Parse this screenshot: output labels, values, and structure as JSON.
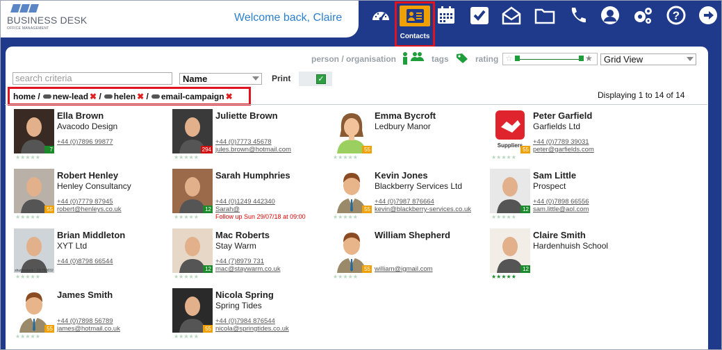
{
  "brand": {
    "name": "BUSINESS DESK",
    "tagline": "OFFICE MANAGEMENT"
  },
  "header": {
    "welcome": "Welcome back, Claire"
  },
  "nav": {
    "icons": [
      "dashboard-icon",
      "contacts-icon",
      "calendar-icon",
      "tasks-icon",
      "mail-icon",
      "folder-icon",
      "phone-icon",
      "user-icon",
      "settings-icon",
      "help-icon",
      "logout-icon"
    ],
    "contacts_label": "Contacts"
  },
  "filters": {
    "person_org": "person / organisation",
    "tags": "tags",
    "rating": "rating",
    "view": "Grid View",
    "search_placeholder": "search criteria",
    "sort": "Name",
    "print": "Print"
  },
  "breadcrumb": {
    "home": "home",
    "items": [
      "new-lead",
      "helen",
      "email-campaign"
    ]
  },
  "display_text": "Displaying 1 to 14 of 14",
  "contacts": [
    {
      "name": "Ella Brown",
      "company": "Avacodo Design",
      "phone": "+44 (0)7896 99877",
      "email": "",
      "badge": "7",
      "badge_color": "#1a8a2a",
      "stars_filled": 0,
      "avatar": "photo-ella"
    },
    {
      "name": "Juliette Brown",
      "company": "",
      "phone": "+44 (0)7773 45678",
      "email": "jules.brown@hotmail.com",
      "badge": "294",
      "badge_color": "#d01010",
      "stars_filled": 0,
      "avatar": "photo-juliette"
    },
    {
      "name": "Emma Bycroft",
      "company": "Ledbury Manor",
      "phone": "",
      "email": "",
      "badge": "55",
      "badge_color": "#f0a000",
      "stars_filled": 0,
      "avatar": "female-avatar"
    },
    {
      "name": "Peter Garfield",
      "company": "Garfields Ltd",
      "phone": "+44 (0)7789 39031",
      "email": "peter@garfields.com",
      "badge": "55",
      "badge_color": "#f0a000",
      "stars_filled": 0,
      "avatar": "suppliers-logo",
      "logo_text": "Suppliers"
    },
    {
      "name": "Robert Henley",
      "company": "Henley Consultancy",
      "phone": "+44 (0)7779 87945",
      "email": "robert@henleys.co.uk",
      "badge": "55",
      "badge_color": "#f0a000",
      "stars_filled": 0,
      "avatar": "photo-robert"
    },
    {
      "name": "Sarah Humphries",
      "company": "",
      "phone": "+44 (0)1249 442340",
      "email": "Sarah@",
      "follow": "Follow up Sun 29/07/18 at 09:00",
      "badge": "12",
      "badge_color": "#1a8a2a",
      "stars_filled": 0,
      "avatar": "photo-sarah"
    },
    {
      "name": "Kevin Jones",
      "company": "Blackberry Services Ltd",
      "phone": "+44 (0)7987 876664",
      "email": "kevin@blackberry-services.co.uk",
      "badge": "55",
      "badge_color": "#f0a000",
      "stars_filled": 0,
      "avatar": "male-avatar"
    },
    {
      "name": "Sam Little",
      "company": "Prospect",
      "phone": "+44 (0)7898 66556",
      "email": "sam.little@aol.com",
      "badge": "12",
      "badge_color": "#1a8a2a",
      "stars_filled": 0,
      "avatar": "photo-sam"
    },
    {
      "name": "Brian Middleton",
      "company": "XYT Ltd",
      "phone": "+44 (0)8798 66544",
      "email": "",
      "badge": "",
      "badge_color": "#1a8a2a",
      "stars_filled": 0,
      "avatar": "photo-brian",
      "logo_text": "shutterstock - 111750032"
    },
    {
      "name": "Mac Roberts",
      "company": "Stay Warm",
      "phone": "+44 (7)8979 731",
      "email": "mac@staywarm.co.uk",
      "badge": "12",
      "badge_color": "#1a8a2a",
      "stars_filled": 0,
      "avatar": "photo-mac"
    },
    {
      "name": "William Shepherd",
      "company": "",
      "phone": "",
      "email": "william@igmail.com",
      "badge": "55",
      "badge_color": "#f0a000",
      "stars_filled": 0,
      "avatar": "male-avatar"
    },
    {
      "name": "Claire Smith",
      "company": "Hardenhuish School",
      "phone": "",
      "email": "",
      "badge": "12",
      "badge_color": "#1a8a2a",
      "stars_filled": 5,
      "avatar": "photo-claire"
    },
    {
      "name": "James Smith",
      "company": "",
      "phone": "+44 (0)7898 56789",
      "email": "james@hotmail.co.uk",
      "badge": "55",
      "badge_color": "#f0a000",
      "stars_filled": 0,
      "avatar": "male-avatar"
    },
    {
      "name": "Nicola Spring",
      "company": "Spring Tides",
      "phone": "+44 (0)7984 876544",
      "email": "nicola@springtides.co.uk",
      "badge": "55",
      "badge_color": "#f0a000",
      "stars_filled": 0,
      "avatar": "photo-nicola"
    }
  ]
}
